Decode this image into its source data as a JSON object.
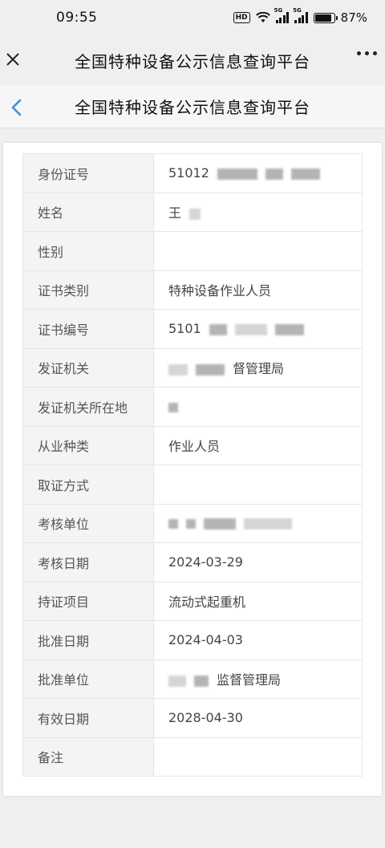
{
  "status_bar": {
    "time": "09:55",
    "hd_label": "HD",
    "sim1_label": "5G",
    "sim2_label": "5G",
    "battery_percent": "87%",
    "battery_level": 0.87
  },
  "app_bar": {
    "title": "全国特种设备公示信息查询平台",
    "close_icon": "close-icon",
    "more_icon": "more-icon"
  },
  "page_nav": {
    "title": "全国特种设备公示信息查询平台",
    "back_icon": "chevron-left-icon"
  },
  "colors": {
    "accent": "#3f8fd8",
    "background": "#efeff1",
    "label_cell": "#f4f4f4",
    "border": "#e6e6e6"
  },
  "rows": [
    {
      "label": "身份证号",
      "value": "51012"
    },
    {
      "label": "姓名",
      "value": "王"
    },
    {
      "label": "性别",
      "value": ""
    },
    {
      "label": "证书类别",
      "value": "特种设备作业人员"
    },
    {
      "label": "证书编号",
      "value": "5101"
    },
    {
      "label": "发证机关",
      "value": "督管理局"
    },
    {
      "label": "发证机关所在地",
      "value": ""
    },
    {
      "label": "从业种类",
      "value": "作业人员"
    },
    {
      "label": "取证方式",
      "value": ""
    },
    {
      "label": "考核单位",
      "value": ""
    },
    {
      "label": "考核日期",
      "value": "2024-03-29"
    },
    {
      "label": "持证项目",
      "value": "流动式起重机"
    },
    {
      "label": "批准日期",
      "value": "2024-04-03"
    },
    {
      "label": "批准单位",
      "value": "监督管理局"
    },
    {
      "label": "有效日期",
      "value": "2028-04-30"
    },
    {
      "label": "备注",
      "value": ""
    }
  ]
}
